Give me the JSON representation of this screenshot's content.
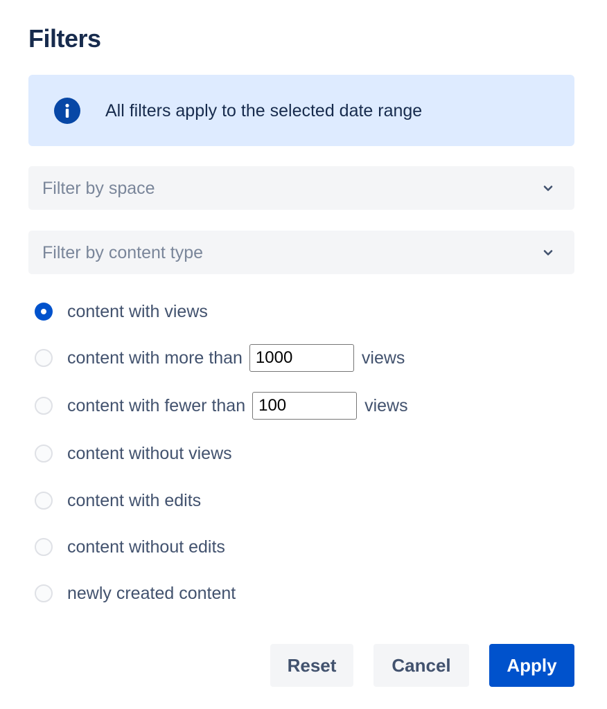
{
  "dialog": {
    "title": "Filters"
  },
  "info_banner": {
    "icon": "info-icon",
    "text": "All filters apply to the selected date range",
    "background": "#deebff",
    "icon_color": "#0747a6"
  },
  "selects": {
    "space": {
      "placeholder": "Filter by space",
      "icon": "chevron-down-icon"
    },
    "content_type": {
      "placeholder": "Filter by content type",
      "icon": "chevron-down-icon"
    }
  },
  "options": {
    "with_views": {
      "label": "content with views",
      "checked": true
    },
    "more_than": {
      "label": "content with more than",
      "value": "1000",
      "suffix": "views",
      "checked": false
    },
    "fewer_than": {
      "label": "content with fewer than",
      "value": "100",
      "suffix": "views",
      "checked": false
    },
    "without_views": {
      "label": "content without views",
      "checked": false
    },
    "with_edits": {
      "label": "content with edits",
      "checked": false
    },
    "without_edits": {
      "label": "content without edits",
      "checked": false
    },
    "newly_created": {
      "label": "newly created content",
      "checked": false
    }
  },
  "actions": {
    "reset_label": "Reset",
    "cancel_label": "Cancel",
    "apply_label": "Apply"
  },
  "colors": {
    "primary": "#0052cc",
    "heading": "#172b4d",
    "text": "#42526e",
    "placeholder": "#7a869a",
    "neutral_bg": "#f4f5f7"
  }
}
